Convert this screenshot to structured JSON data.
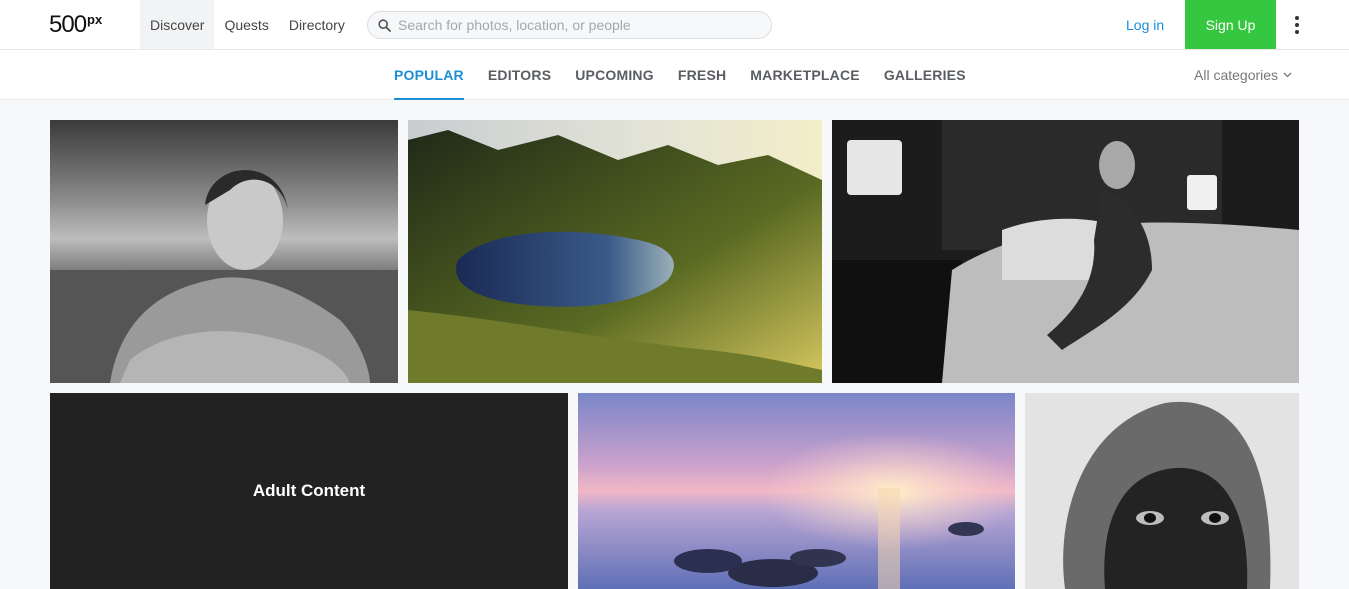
{
  "header": {
    "logo_text": "500",
    "logo_superscript": "px",
    "nav": [
      "Discover",
      "Quests",
      "Directory"
    ],
    "search_placeholder": "Search for photos, location, or people",
    "login_label": "Log in",
    "signup_label": "Sign Up",
    "signup_color": "#35c73f",
    "more_icon": "vertical-ellipsis-icon"
  },
  "subnav": {
    "tabs": [
      "POPULAR",
      "EDITORS",
      "UPCOMING",
      "FRESH",
      "MARKETPLACE",
      "GALLERIES"
    ],
    "active_tab": "POPULAR",
    "accent_color": "#1a8fd6",
    "categories_label": "All categories"
  },
  "photos": {
    "adult_label": "Adult Content"
  }
}
